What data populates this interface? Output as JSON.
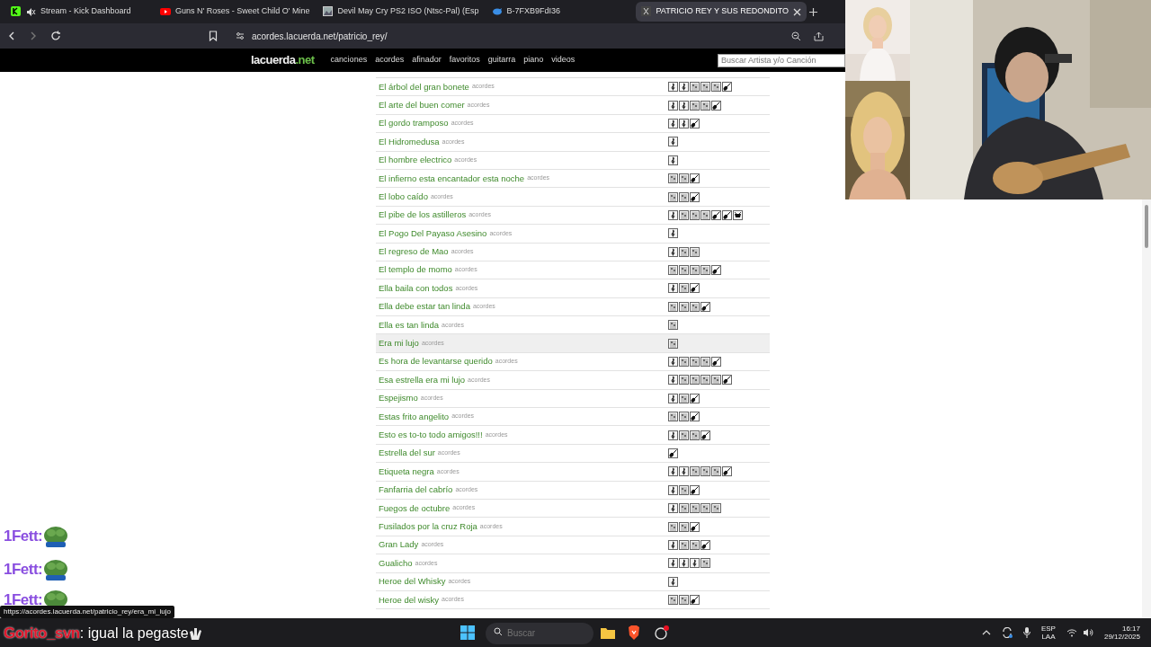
{
  "browser": {
    "tabs": [
      {
        "title": "Stream - Kick Dashboard",
        "selected": false,
        "muted": true
      },
      {
        "title": "Guns N' Roses - Sweet Child O' Mine",
        "selected": false,
        "muted": false
      },
      {
        "title": "Devil May Cry PS2 ISO (Ntsc-Pal) (Esp",
        "selected": false,
        "muted": false
      },
      {
        "title": "B-7FXB9FdI36",
        "selected": false,
        "muted": false
      },
      {
        "title": "PATRICIO REY Y SUS REDONDITO",
        "selected": true,
        "muted": false
      }
    ],
    "url": "acordes.lacuerda.net/patricio_rey/"
  },
  "site": {
    "logo": {
      "name": "lacuerda",
      "suffix": ".net"
    },
    "links": [
      "canciones",
      "acordes",
      "afinador",
      "favoritos",
      "guitarra",
      "piano",
      "videos"
    ],
    "search": {
      "placeholder": "Buscar Artista y/o Canción"
    }
  },
  "songs": [
    {
      "title": "El árbol del gran bonete",
      "tag": "acordes",
      "hovered": false,
      "versions": [
        {
          "kind": "clef"
        },
        {
          "kind": "clef"
        },
        {
          "kind": "tab"
        },
        {
          "kind": "tab"
        },
        {
          "kind": "tab"
        },
        {
          "kind": "guitar"
        }
      ]
    },
    {
      "title": "El arte del buen comer",
      "tag": "acordes",
      "hovered": false,
      "versions": [
        {
          "kind": "clef"
        },
        {
          "kind": "clef"
        },
        {
          "kind": "tab"
        },
        {
          "kind": "tab"
        },
        {
          "kind": "guitar"
        }
      ]
    },
    {
      "title": "El gordo tramposo",
      "tag": "acordes",
      "hovered": false,
      "versions": [
        {
          "kind": "clef"
        },
        {
          "kind": "clef"
        },
        {
          "kind": "guitar"
        }
      ]
    },
    {
      "title": "El Hidromedusa",
      "tag": "acordes",
      "hovered": false,
      "versions": [
        {
          "kind": "clef"
        }
      ]
    },
    {
      "title": "El hombre electrico",
      "tag": "acordes",
      "hovered": false,
      "versions": [
        {
          "kind": "clef"
        }
      ]
    },
    {
      "title": "El infierno esta encantador esta noche",
      "tag": "acordes",
      "hovered": false,
      "versions": [
        {
          "kind": "tab"
        },
        {
          "kind": "tab"
        },
        {
          "kind": "guitar"
        }
      ]
    },
    {
      "title": "El lobo caído",
      "tag": "acordes",
      "hovered": false,
      "versions": [
        {
          "kind": "tab"
        },
        {
          "kind": "tab"
        },
        {
          "kind": "guitar"
        }
      ]
    },
    {
      "title": "El pibe de los astilleros",
      "tag": "acordes",
      "hovered": false,
      "versions": [
        {
          "kind": "clef"
        },
        {
          "kind": "tab"
        },
        {
          "kind": "tab"
        },
        {
          "kind": "tab"
        },
        {
          "kind": "guitar"
        },
        {
          "kind": "guitar"
        },
        {
          "kind": "drum"
        }
      ]
    },
    {
      "title": "El Pogo Del Payaso Asesino",
      "tag": "acordes",
      "hovered": false,
      "versions": [
        {
          "kind": "clef"
        }
      ]
    },
    {
      "title": "El regreso de Mao",
      "tag": "acordes",
      "hovered": false,
      "versions": [
        {
          "kind": "clef"
        },
        {
          "kind": "tab"
        },
        {
          "kind": "tab"
        }
      ]
    },
    {
      "title": "El templo de momo",
      "tag": "acordes",
      "hovered": false,
      "versions": [
        {
          "kind": "tab"
        },
        {
          "kind": "tab"
        },
        {
          "kind": "tab"
        },
        {
          "kind": "tab"
        },
        {
          "kind": "guitar"
        }
      ]
    },
    {
      "title": "Ella baila con todos",
      "tag": "acordes",
      "hovered": false,
      "versions": [
        {
          "kind": "clef"
        },
        {
          "kind": "tab"
        },
        {
          "kind": "guitar"
        }
      ]
    },
    {
      "title": "Ella debe estar tan linda",
      "tag": "acordes",
      "hovered": false,
      "versions": [
        {
          "kind": "tab"
        },
        {
          "kind": "tab"
        },
        {
          "kind": "tab"
        },
        {
          "kind": "guitar"
        }
      ]
    },
    {
      "title": "Ella es tan linda",
      "tag": "acordes",
      "hovered": false,
      "versions": [
        {
          "kind": "tab"
        }
      ]
    },
    {
      "title": "Era mi lujo",
      "tag": "acordes",
      "hovered": true,
      "versions": [
        {
          "kind": "tab"
        }
      ]
    },
    {
      "title": "Es hora de levantarse querido",
      "tag": "acordes",
      "hovered": false,
      "versions": [
        {
          "kind": "clef"
        },
        {
          "kind": "tab"
        },
        {
          "kind": "tab"
        },
        {
          "kind": "tab"
        },
        {
          "kind": "guitar"
        }
      ]
    },
    {
      "title": "Esa estrella era mi lujo",
      "tag": "acordes",
      "hovered": false,
      "versions": [
        {
          "kind": "clef"
        },
        {
          "kind": "tab"
        },
        {
          "kind": "tab"
        },
        {
          "kind": "tab"
        },
        {
          "kind": "tab"
        },
        {
          "kind": "guitar"
        }
      ]
    },
    {
      "title": "Espejismo",
      "tag": "acordes",
      "hovered": false,
      "versions": [
        {
          "kind": "clef"
        },
        {
          "kind": "tab"
        },
        {
          "kind": "guitar"
        }
      ]
    },
    {
      "title": "Estas frito angelito",
      "tag": "acordes",
      "hovered": false,
      "versions": [
        {
          "kind": "tab"
        },
        {
          "kind": "tab"
        },
        {
          "kind": "guitar"
        }
      ]
    },
    {
      "title": "Esto es to-to todo amigos!!!",
      "tag": "acordes",
      "hovered": false,
      "versions": [
        {
          "kind": "clef"
        },
        {
          "kind": "tab"
        },
        {
          "kind": "tab"
        },
        {
          "kind": "guitar"
        }
      ]
    },
    {
      "title": "Estrella del sur",
      "tag": "acordes",
      "hovered": false,
      "versions": [
        {
          "kind": "guitar"
        }
      ]
    },
    {
      "title": "Etiqueta negra",
      "tag": "acordes",
      "hovered": false,
      "versions": [
        {
          "kind": "clef"
        },
        {
          "kind": "clef"
        },
        {
          "kind": "tab"
        },
        {
          "kind": "tab"
        },
        {
          "kind": "tab"
        },
        {
          "kind": "guitar"
        }
      ]
    },
    {
      "title": "Fanfarria del cabrío",
      "tag": "acordes",
      "hovered": false,
      "versions": [
        {
          "kind": "clef"
        },
        {
          "kind": "tab"
        },
        {
          "kind": "guitar"
        }
      ]
    },
    {
      "title": "Fuegos de octubre",
      "tag": "acordes",
      "hovered": false,
      "versions": [
        {
          "kind": "clef"
        },
        {
          "kind": "tab"
        },
        {
          "kind": "tab"
        },
        {
          "kind": "tab"
        },
        {
          "kind": "tab"
        }
      ]
    },
    {
      "title": "Fusilados por la cruz Roja",
      "tag": "acordes",
      "hovered": false,
      "versions": [
        {
          "kind": "tab"
        },
        {
          "kind": "tab"
        },
        {
          "kind": "guitar"
        }
      ]
    },
    {
      "title": "Gran Lady",
      "tag": "acordes",
      "hovered": false,
      "versions": [
        {
          "kind": "clef"
        },
        {
          "kind": "tab"
        },
        {
          "kind": "tab"
        },
        {
          "kind": "guitar"
        }
      ]
    },
    {
      "title": "Gualicho",
      "tag": "acordes",
      "hovered": false,
      "versions": [
        {
          "kind": "clef"
        },
        {
          "kind": "clef"
        },
        {
          "kind": "clef"
        },
        {
          "kind": "tab"
        }
      ]
    },
    {
      "title": "Heroe del Whisky",
      "tag": "acordes",
      "hovered": false,
      "versions": [
        {
          "kind": "clef"
        }
      ]
    },
    {
      "title": "Heroe del wisky",
      "tag": "acordes",
      "hovered": false,
      "versions": [
        {
          "kind": "tab"
        },
        {
          "kind": "tab"
        },
        {
          "kind": "guitar"
        }
      ]
    }
  ],
  "chat": [
    {
      "user": "1Fett:",
      "color": "#8a4fe0"
    },
    {
      "user": "1Fett:",
      "color": "#8a4fe0"
    },
    {
      "user": "1Fett:",
      "color": "#8a4fe0"
    },
    {
      "user": "Gorito_svn",
      "color": "#e0182d",
      "message": ": igual la pegaste"
    }
  ],
  "status_url": "https://acordes.lacuerda.net/patricio_rey/era_mi_lujo",
  "taskbar": {
    "search": {
      "placeholder": "Buscar"
    },
    "language": "ESP",
    "layout": "LAA",
    "time": "16:17",
    "date": "29/12/2025"
  }
}
